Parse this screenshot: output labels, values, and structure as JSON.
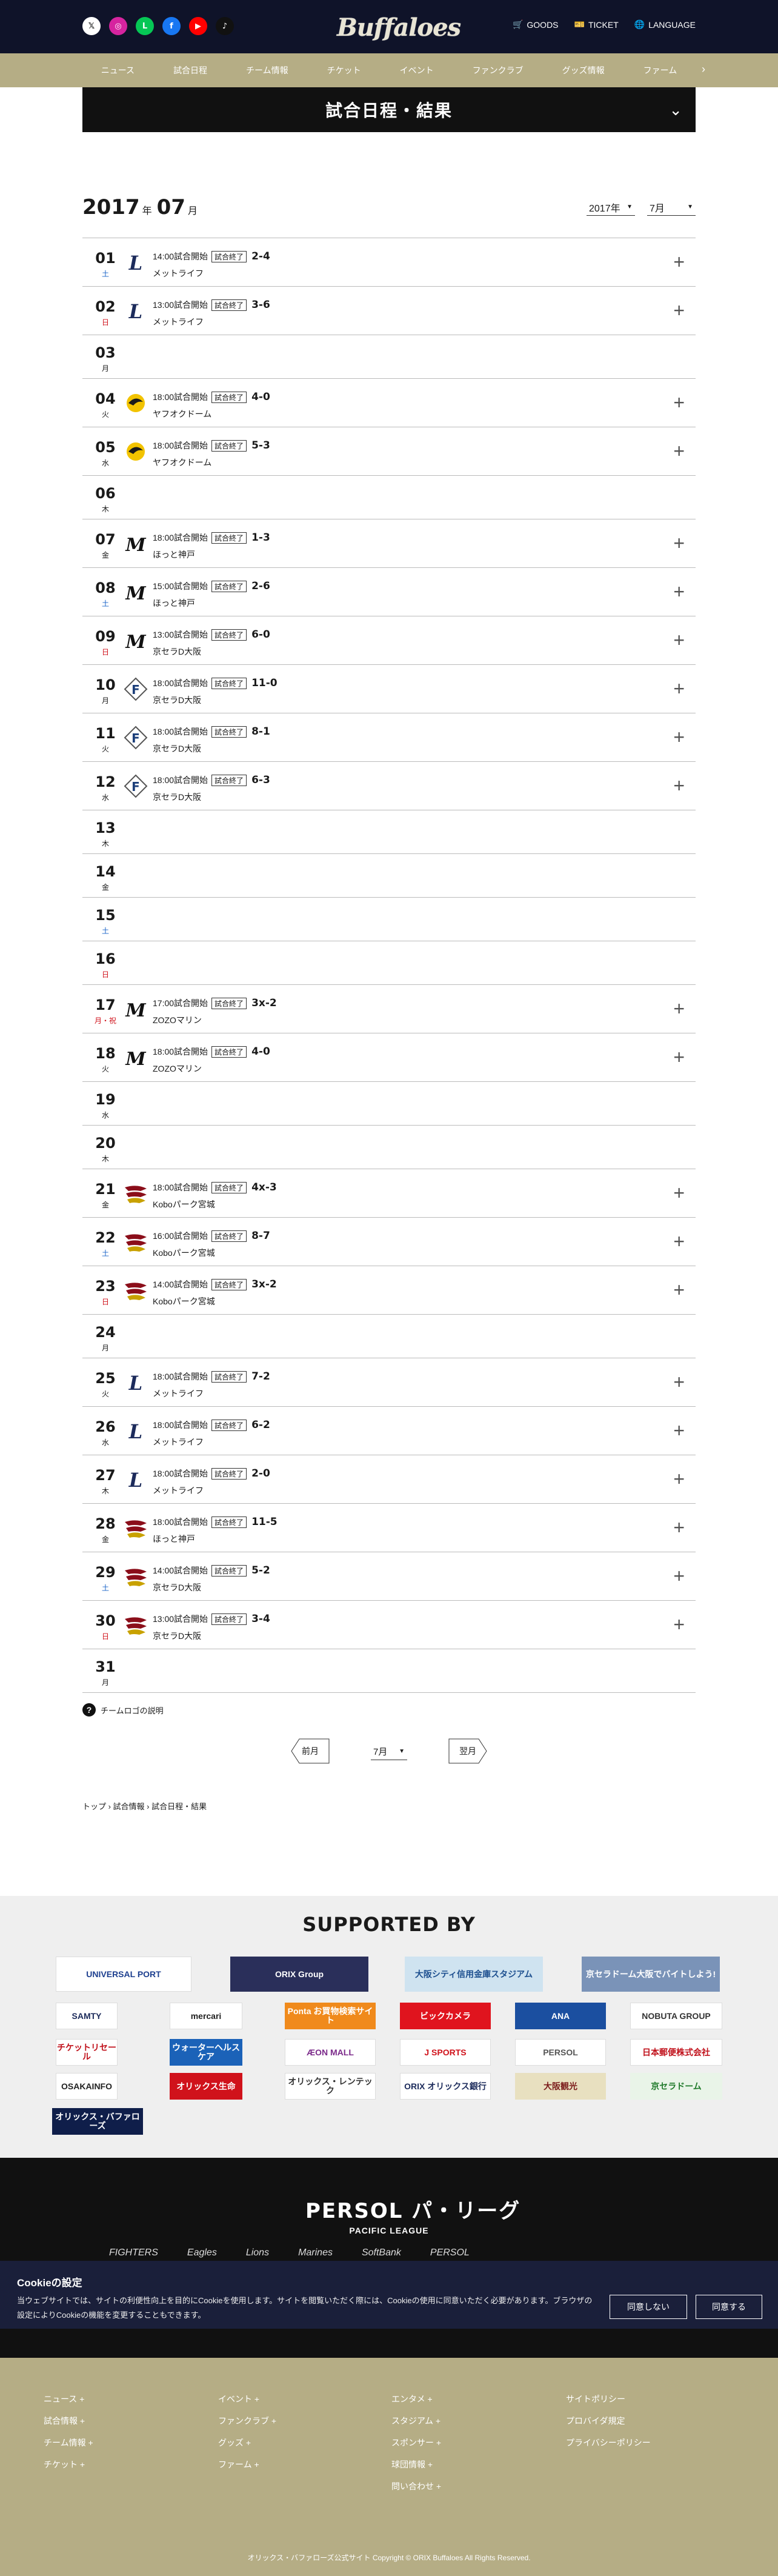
{
  "header": {
    "logo_text": "Buffaloes",
    "links": {
      "goods": "GOODS",
      "ticket": "TICKET",
      "language": "LANGUAGE"
    },
    "social": [
      {
        "name": "x",
        "glyph": "𝕏",
        "color": "#ffffff",
        "text": "#111"
      },
      {
        "name": "instagram",
        "glyph": "◎",
        "color": "#d6249f",
        "text": "#fff"
      },
      {
        "name": "line",
        "glyph": "L",
        "color": "#06c755",
        "text": "#fff"
      },
      {
        "name": "facebook",
        "glyph": "f",
        "color": "#1877f2",
        "text": "#fff"
      },
      {
        "name": "youtube",
        "glyph": "▶",
        "color": "#ff0000",
        "text": "#fff"
      },
      {
        "name": "tiktok",
        "glyph": "♪",
        "color": "#111111",
        "text": "#fff"
      }
    ]
  },
  "nav": [
    "ニュース",
    "試合日程",
    "チーム情報",
    "チケット",
    "イベント",
    "ファンクラブ",
    "グッズ情報",
    "ファーム"
  ],
  "page_title": "試合日程・結果",
  "month_header": {
    "year": "2017",
    "year_unit": "年",
    "month": "07",
    "month_unit": "月",
    "year_select": "2017年",
    "month_select": "7月"
  },
  "game_badge": "試合終了",
  "days": [
    {
      "d": "01",
      "dow": "土",
      "type": "sat",
      "opp": "lions",
      "time": "14:00試合開始",
      "score": "2-4",
      "venue": "メットライフ"
    },
    {
      "d": "02",
      "dow": "日",
      "type": "sun",
      "opp": "lions",
      "time": "13:00試合開始",
      "score": "3-6",
      "venue": "メットライフ"
    },
    {
      "d": "03",
      "dow": "月",
      "type": "wk"
    },
    {
      "d": "04",
      "dow": "火",
      "type": "wk",
      "opp": "hawks",
      "time": "18:00試合開始",
      "score": "4-0",
      "venue": "ヤフオクドーム"
    },
    {
      "d": "05",
      "dow": "水",
      "type": "wk",
      "opp": "hawks",
      "time": "18:00試合開始",
      "score": "5-3",
      "venue": "ヤフオクドーム"
    },
    {
      "d": "06",
      "dow": "木",
      "type": "wk"
    },
    {
      "d": "07",
      "dow": "金",
      "type": "wk",
      "opp": "marines",
      "time": "18:00試合開始",
      "score": "1-3",
      "venue": "ほっと神戸"
    },
    {
      "d": "08",
      "dow": "土",
      "type": "sat",
      "opp": "marines",
      "time": "15:00試合開始",
      "score": "2-6",
      "venue": "ほっと神戸"
    },
    {
      "d": "09",
      "dow": "日",
      "type": "sun",
      "opp": "marines",
      "time": "13:00試合開始",
      "score": "6-0",
      "venue": "京セラD大阪"
    },
    {
      "d": "10",
      "dow": "月",
      "type": "wk",
      "opp": "fighters",
      "time": "18:00試合開始",
      "score": "11-0",
      "venue": "京セラD大阪"
    },
    {
      "d": "11",
      "dow": "火",
      "type": "wk",
      "opp": "fighters",
      "time": "18:00試合開始",
      "score": "8-1",
      "venue": "京セラD大阪"
    },
    {
      "d": "12",
      "dow": "水",
      "type": "wk",
      "opp": "fighters",
      "time": "18:00試合開始",
      "score": "6-3",
      "venue": "京セラD大阪"
    },
    {
      "d": "13",
      "dow": "木",
      "type": "wk"
    },
    {
      "d": "14",
      "dow": "金",
      "type": "wk"
    },
    {
      "d": "15",
      "dow": "土",
      "type": "sat"
    },
    {
      "d": "16",
      "dow": "日",
      "type": "sun"
    },
    {
      "d": "17",
      "dow": "月・祝",
      "type": "hol",
      "opp": "marines",
      "time": "17:00試合開始",
      "score": "3x-2",
      "venue": "ZOZOマリン"
    },
    {
      "d": "18",
      "dow": "火",
      "type": "wk",
      "opp": "marines",
      "time": "18:00試合開始",
      "score": "4-0",
      "venue": "ZOZOマリン"
    },
    {
      "d": "19",
      "dow": "水",
      "type": "wk"
    },
    {
      "d": "20",
      "dow": "木",
      "type": "wk"
    },
    {
      "d": "21",
      "dow": "金",
      "type": "wk",
      "opp": "eagles",
      "time": "18:00試合開始",
      "score": "4x-3",
      "venue": "Koboパーク宮城"
    },
    {
      "d": "22",
      "dow": "土",
      "type": "sat",
      "opp": "eagles",
      "time": "16:00試合開始",
      "score": "8-7",
      "venue": "Koboパーク宮城"
    },
    {
      "d": "23",
      "dow": "日",
      "type": "sun",
      "opp": "eagles",
      "time": "14:00試合開始",
      "score": "3x-2",
      "venue": "Koboパーク宮城"
    },
    {
      "d": "24",
      "dow": "月",
      "type": "wk"
    },
    {
      "d": "25",
      "dow": "火",
      "type": "wk",
      "opp": "lions",
      "time": "18:00試合開始",
      "score": "7-2",
      "venue": "メットライフ"
    },
    {
      "d": "26",
      "dow": "水",
      "type": "wk",
      "opp": "lions",
      "time": "18:00試合開始",
      "score": "6-2",
      "venue": "メットライフ"
    },
    {
      "d": "27",
      "dow": "木",
      "type": "wk",
      "opp": "lions",
      "time": "18:00試合開始",
      "score": "2-0",
      "venue": "メットライフ"
    },
    {
      "d": "28",
      "dow": "金",
      "type": "wk",
      "opp": "eagles",
      "time": "18:00試合開始",
      "score": "11-5",
      "venue": "ほっと神戸"
    },
    {
      "d": "29",
      "dow": "土",
      "type": "sat",
      "opp": "eagles",
      "time": "14:00試合開始",
      "score": "5-2",
      "venue": "京セラD大阪"
    },
    {
      "d": "30",
      "dow": "日",
      "type": "sun",
      "opp": "eagles",
      "time": "13:00試合開始",
      "score": "3-4",
      "venue": "京セラD大阪"
    },
    {
      "d": "31",
      "dow": "月",
      "type": "wk"
    }
  ],
  "legend_label": "チームロゴの説明",
  "pager": {
    "prev": "前月",
    "select": "7月",
    "next": "翌月"
  },
  "breadcrumb": "トップ › 試合情報 › 試合日程・結果",
  "sponsors_title": "SUPPORTED BY",
  "sponsors": [
    {
      "label": "UNIVERSAL PORT",
      "bg": "#ffffff",
      "fg": "#1d3f8f"
    },
    {
      "label": "ORIX Group",
      "bg": "#2a2f5a",
      "fg": "#ffffff"
    },
    {
      "label": "大阪シティ信用金庫スタジアム",
      "bg": "#cfe3f0",
      "fg": "#1d4f8f"
    },
    {
      "label": "京セラドーム大阪でバイトしよう!",
      "bg": "#7a93b8",
      "fg": "#ffffff"
    },
    {
      "label": "SAMTY",
      "bg": "#ffffff",
      "fg": "#1c2b5b"
    },
    {
      "label": "mercari",
      "bg": "#ffffff",
      "fg": "#222"
    },
    {
      "label": "Ponta お買物検索サイト",
      "bg": "#f08a1c",
      "fg": "#ffffff"
    },
    {
      "label": "ビックカメラ",
      "bg": "#e0141e",
      "fg": "#ffffff"
    },
    {
      "label": "ANA",
      "bg": "#1b4fa0",
      "fg": "#ffffff"
    },
    {
      "label": "NOBUTA GROUP",
      "bg": "#ffffff",
      "fg": "#333"
    },
    {
      "label": "チケットリセール",
      "bg": "#ffffff",
      "fg": "#c0101a"
    },
    {
      "label": "ウォーターヘルスケア",
      "bg": "#1b62b8",
      "fg": "#ffffff"
    },
    {
      "label": "ÆON MALL",
      "bg": "#ffffff",
      "fg": "#7b2a8a"
    },
    {
      "label": "J SPORTS",
      "bg": "#ffffff",
      "fg": "#d0121b"
    },
    {
      "label": "PERSOL",
      "bg": "#ffffff",
      "fg": "#555"
    },
    {
      "label": "日本郵便株式会社",
      "bg": "#ffffff",
      "fg": "#c0101a"
    },
    {
      "label": "OSAKAINFO",
      "bg": "#ffffff",
      "fg": "#222"
    },
    {
      "label": "オリックス生命",
      "bg": "#d0121b",
      "fg": "#ffffff"
    },
    {
      "label": "オリックス・レンテック",
      "bg": "#ffffff",
      "fg": "#333"
    },
    {
      "label": "ORIX オリックス銀行",
      "bg": "#ffffff",
      "fg": "#1c2b5b"
    },
    {
      "label": "大阪観光",
      "bg": "#e8e0c0",
      "fg": "#7a1a1a"
    },
    {
      "label": "京セラドーム",
      "bg": "#e9f4e8",
      "fg": "#1f7a2a"
    },
    {
      "label": "オリックス・バファローズ",
      "bg": "#0f1e4a",
      "fg": "#ffffff"
    }
  ],
  "league": {
    "brand": "PERSOL パ・リーグ",
    "sub": "PACIFIC LEAGUE",
    "teams": [
      "FIGHTERS",
      "Eagles",
      "Lions",
      "Marines",
      "SoftBank",
      "PERSOL"
    ]
  },
  "cookie": {
    "title": "Cookieの設定",
    "body": "当ウェブサイトでは、サイトの利便性向上を目的にCookieを使用します。サイトを閲覧いただく際には、Cookieの使用に同意いただく必要があります。ブラウザの設定によりCookieの機能を変更することもできます。",
    "deny": "同意しない",
    "accept": "同意する"
  },
  "footer": {
    "col1": [
      "ニュース",
      "試合情報",
      "チーム情報",
      "チケット"
    ],
    "col2": [
      "イベント",
      "ファンクラブ",
      "グッズ",
      "ファーム"
    ],
    "col3": [
      "エンタメ",
      "スタジアム",
      "スポンサー",
      "球団情報",
      "問い合わせ"
    ],
    "col4": [
      "サイトポリシー",
      "プロバイダ規定",
      "プライバシーポリシー"
    ],
    "copyright": "オリックス・バファローズ公式サイト Copyright © ORIX Buffaloes All Rights Reserved."
  }
}
